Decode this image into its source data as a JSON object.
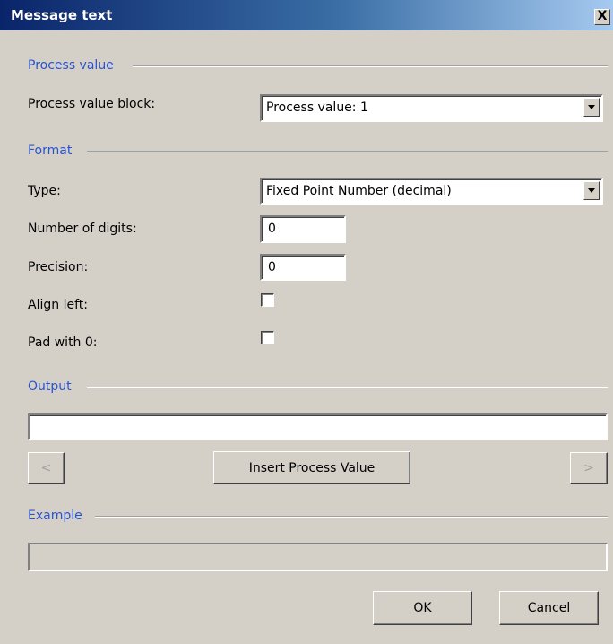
{
  "window": {
    "title": "Message text",
    "close_label": "X"
  },
  "process_value": {
    "group_label": "Process value",
    "block_label": "Process value block:",
    "block_value": "Process value:  1"
  },
  "format": {
    "group_label": "Format",
    "type_label": "Type:",
    "type_value": "Fixed Point Number (decimal)",
    "digits_label": "Number of digits:",
    "digits_value": "0",
    "precision_label": "Precision:",
    "precision_value": "0",
    "align_left_label": "Align left:",
    "align_left_checked": false,
    "pad_label": "Pad with 0:",
    "pad_checked": false
  },
  "output": {
    "group_label": "Output",
    "value": "",
    "prev_label": "<",
    "insert_label": "Insert Process Value",
    "next_label": ">"
  },
  "example": {
    "group_label": "Example",
    "value": ""
  },
  "buttons": {
    "ok": "OK",
    "cancel": "Cancel"
  }
}
